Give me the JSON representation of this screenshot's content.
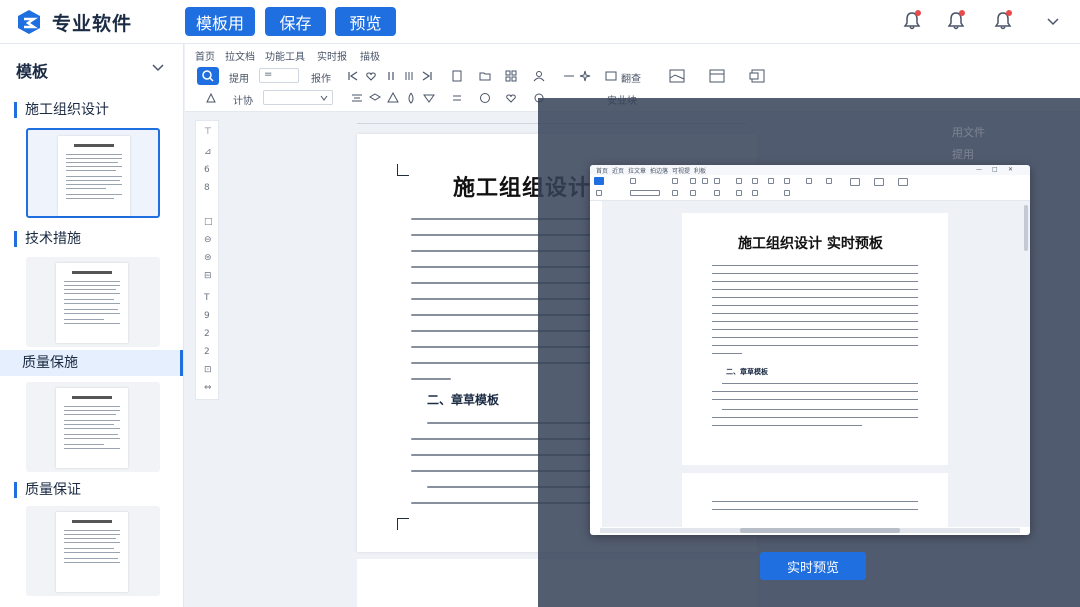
{
  "app": {
    "title": "专业软件",
    "buttons": [
      "模板用",
      "保存",
      "预览"
    ],
    "accent": "#1f6fe0",
    "notification_dot": "#e94b4b"
  },
  "sidebar": {
    "heading": "模板",
    "sections": [
      {
        "label": "施工组织设计",
        "selected": true
      },
      {
        "label": "技术措施"
      },
      {
        "label": "质量保施",
        "active": true
      },
      {
        "label": "质量保证"
      }
    ]
  },
  "editor": {
    "menu": [
      "首页",
      "拉文档",
      "功能工具",
      "实时报",
      "描极"
    ],
    "toolbar": {
      "text_1": "提用",
      "select_1": "=",
      "text_2": "报作",
      "text_3": "计协",
      "text_4": "翻查",
      "text_5": "安业块"
    },
    "document": {
      "title": "施工组组设计设",
      "section_heading": "二、章草模板"
    }
  },
  "overlay": {
    "ghost_label_1": "用文件",
    "ghost_label_2": "提用",
    "preview_window": {
      "menu": [
        "首页",
        "近页",
        "拉文章",
        "拍边落",
        "可视提",
        "利板"
      ],
      "doc_title": "施工组织设计 实时预板",
      "section_heading": "二、章草模板"
    },
    "button": "实时预览"
  }
}
